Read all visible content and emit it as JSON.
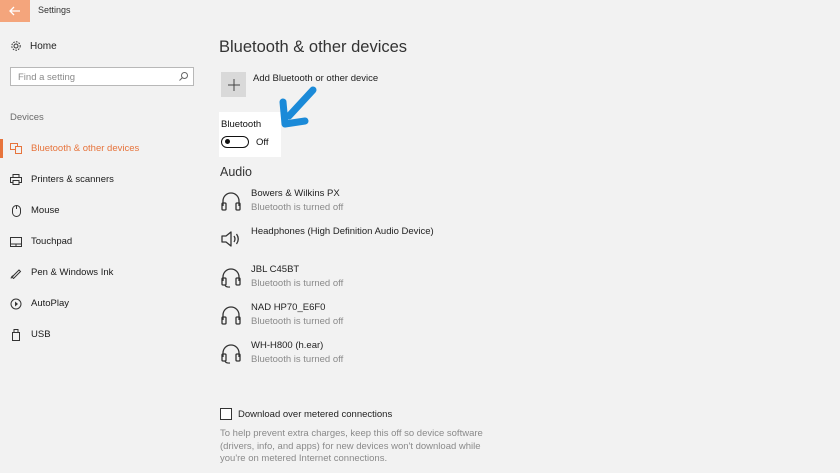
{
  "window": {
    "title": "Settings",
    "accent": "#e7743c"
  },
  "sidebar": {
    "home_label": "Home",
    "search_placeholder": "Find a setting",
    "section_label": "Devices",
    "items": [
      {
        "label": "Bluetooth & other devices",
        "icon": "bluetooth-devices-icon",
        "active": true
      },
      {
        "label": "Printers & scanners",
        "icon": "printer-icon",
        "active": false
      },
      {
        "label": "Mouse",
        "icon": "mouse-icon",
        "active": false
      },
      {
        "label": "Touchpad",
        "icon": "touchpad-icon",
        "active": false
      },
      {
        "label": "Pen & Windows Ink",
        "icon": "pen-icon",
        "active": false
      },
      {
        "label": "AutoPlay",
        "icon": "autoplay-icon",
        "active": false
      },
      {
        "label": "USB",
        "icon": "usb-icon",
        "active": false
      }
    ]
  },
  "main": {
    "title": "Bluetooth & other devices",
    "add_device_label": "Add Bluetooth or other device",
    "bluetooth": {
      "label": "Bluetooth",
      "state": "Off",
      "on": false
    },
    "audio_heading": "Audio",
    "devices": [
      {
        "name": "Bowers & Wilkins PX",
        "status": "Bluetooth is turned off",
        "icon": "headphones-icon"
      },
      {
        "name": "Headphones (High Definition Audio Device)",
        "status": "",
        "icon": "speaker-icon"
      },
      {
        "name": "JBL C45BT",
        "status": "Bluetooth is turned off",
        "icon": "headset-icon"
      },
      {
        "name": "NAD HP70_E6F0",
        "status": "Bluetooth is turned off",
        "icon": "headphones-icon"
      },
      {
        "name": "WH-H800 (h.ear)",
        "status": "Bluetooth is turned off",
        "icon": "headset-icon"
      }
    ],
    "metered": {
      "label": "Download over metered connections",
      "checked": false,
      "description": "To help prevent extra charges, keep this off so device software (drivers, info, and apps) for new devices won't download while you're on metered Internet connections."
    }
  }
}
